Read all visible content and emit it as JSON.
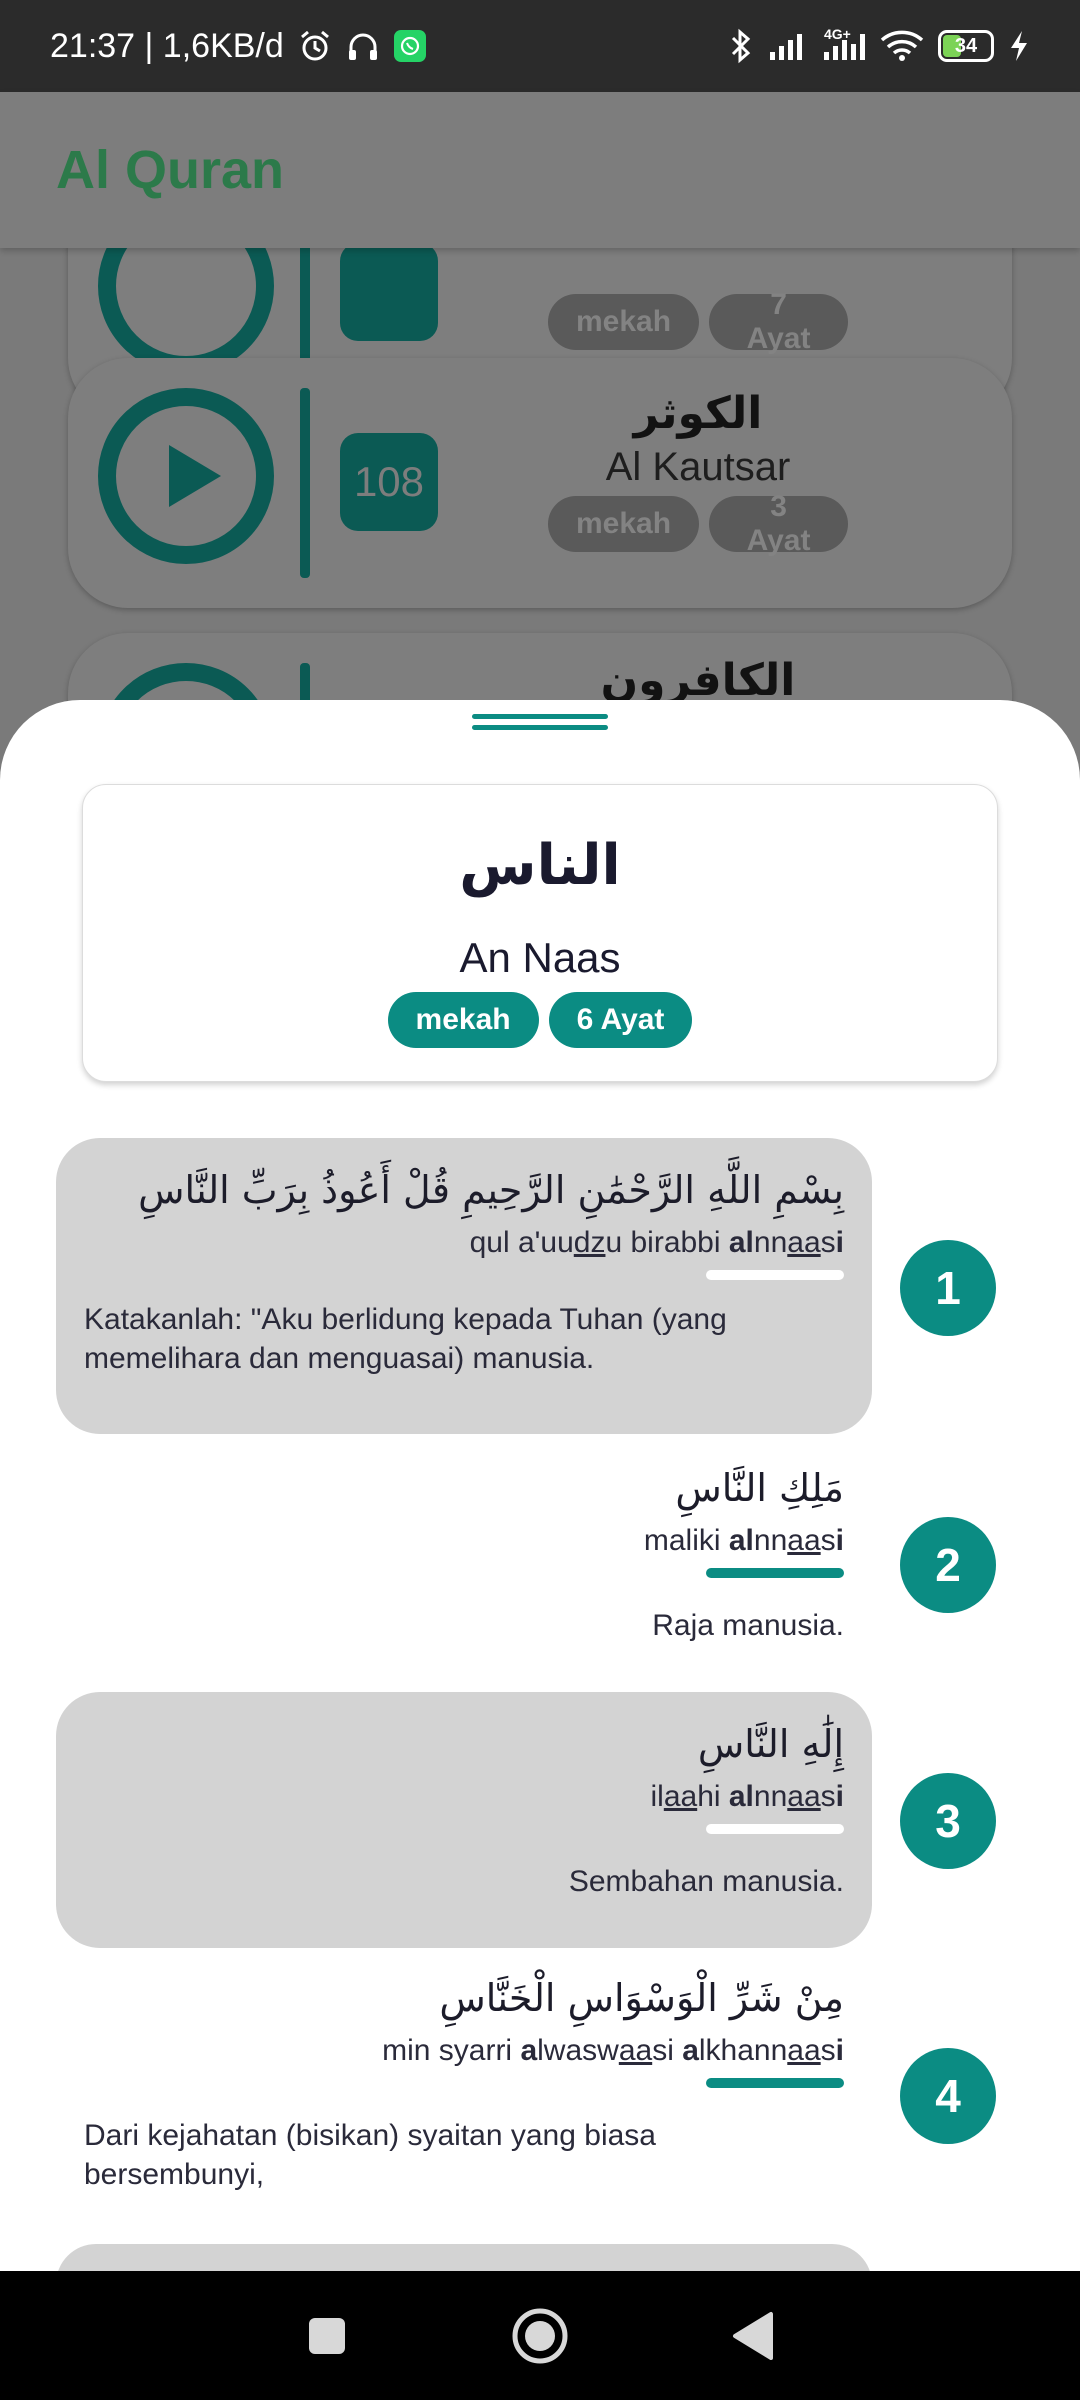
{
  "status_bar": {
    "time_speed": "21:37 | 1,6KB/d",
    "network": "4G+",
    "battery": "34",
    "icons": [
      "alarm-icon",
      "headphones-icon",
      "whatsapp-icon",
      "bluetooth-icon",
      "signal-icon",
      "wifi-icon",
      "battery-icon",
      "charging-icon"
    ]
  },
  "app_bar": {
    "title": "Al Quran"
  },
  "background_list": [
    {
      "number": "",
      "arabic": "",
      "latin": "",
      "place": "mekah",
      "ayat": "7 Ayat"
    },
    {
      "number": "108",
      "arabic": "الكوثر",
      "latin": "Al Kautsar",
      "place": "mekah",
      "ayat": "3 Ayat"
    },
    {
      "number": "",
      "arabic": "الكافرون",
      "latin": "",
      "place": "",
      "ayat": ""
    }
  ],
  "sheet": {
    "surah_arabic": "الناس",
    "surah_latin": "An Naas",
    "place": "mekah",
    "ayat_count": "6 Ayat",
    "ayahs": [
      {
        "number": "1",
        "arabic": "بِسْمِ اللَّهِ الرَّحْمَٰنِ الرَّحِيمِ قُلْ أَعُوذُ بِرَبِّ النَّاسِ",
        "latin_parts": [
          "qul a'uu",
          "dz",
          "u birabbi ",
          "al",
          "nn",
          "aa",
          "s",
          "i"
        ],
        "translation": "Katakanlah: \"Aku berlidung kepada Tuhan (yang memelihara dan menguasai) manusia."
      },
      {
        "number": "2",
        "arabic": "مَلِكِ النَّاسِ",
        "latin_parts": [
          "maliki ",
          "al",
          "nn",
          "aa",
          "s",
          "i"
        ],
        "translation": "Raja manusia."
      },
      {
        "number": "3",
        "arabic": "إِلَٰهِ النَّاسِ",
        "latin_parts": [
          "il",
          "aa",
          "hi ",
          "al",
          "nn",
          "aa",
          "s",
          "i"
        ],
        "translation": "Sembahan manusia."
      },
      {
        "number": "4",
        "arabic": "مِنْ شَرِّ الْوَسْوَاسِ الْخَنَّاسِ",
        "latin_parts": [
          "min syarri ",
          "a",
          "lwasw",
          "aa",
          "si ",
          "a",
          "lkhann",
          "aa",
          "s",
          "i"
        ],
        "translation": "Dari kejahatan (bisikan) syaitan yang biasa bersembunyi,"
      }
    ]
  },
  "nav_bar": {
    "buttons": [
      "recents-button",
      "home-button",
      "back-button"
    ]
  }
}
